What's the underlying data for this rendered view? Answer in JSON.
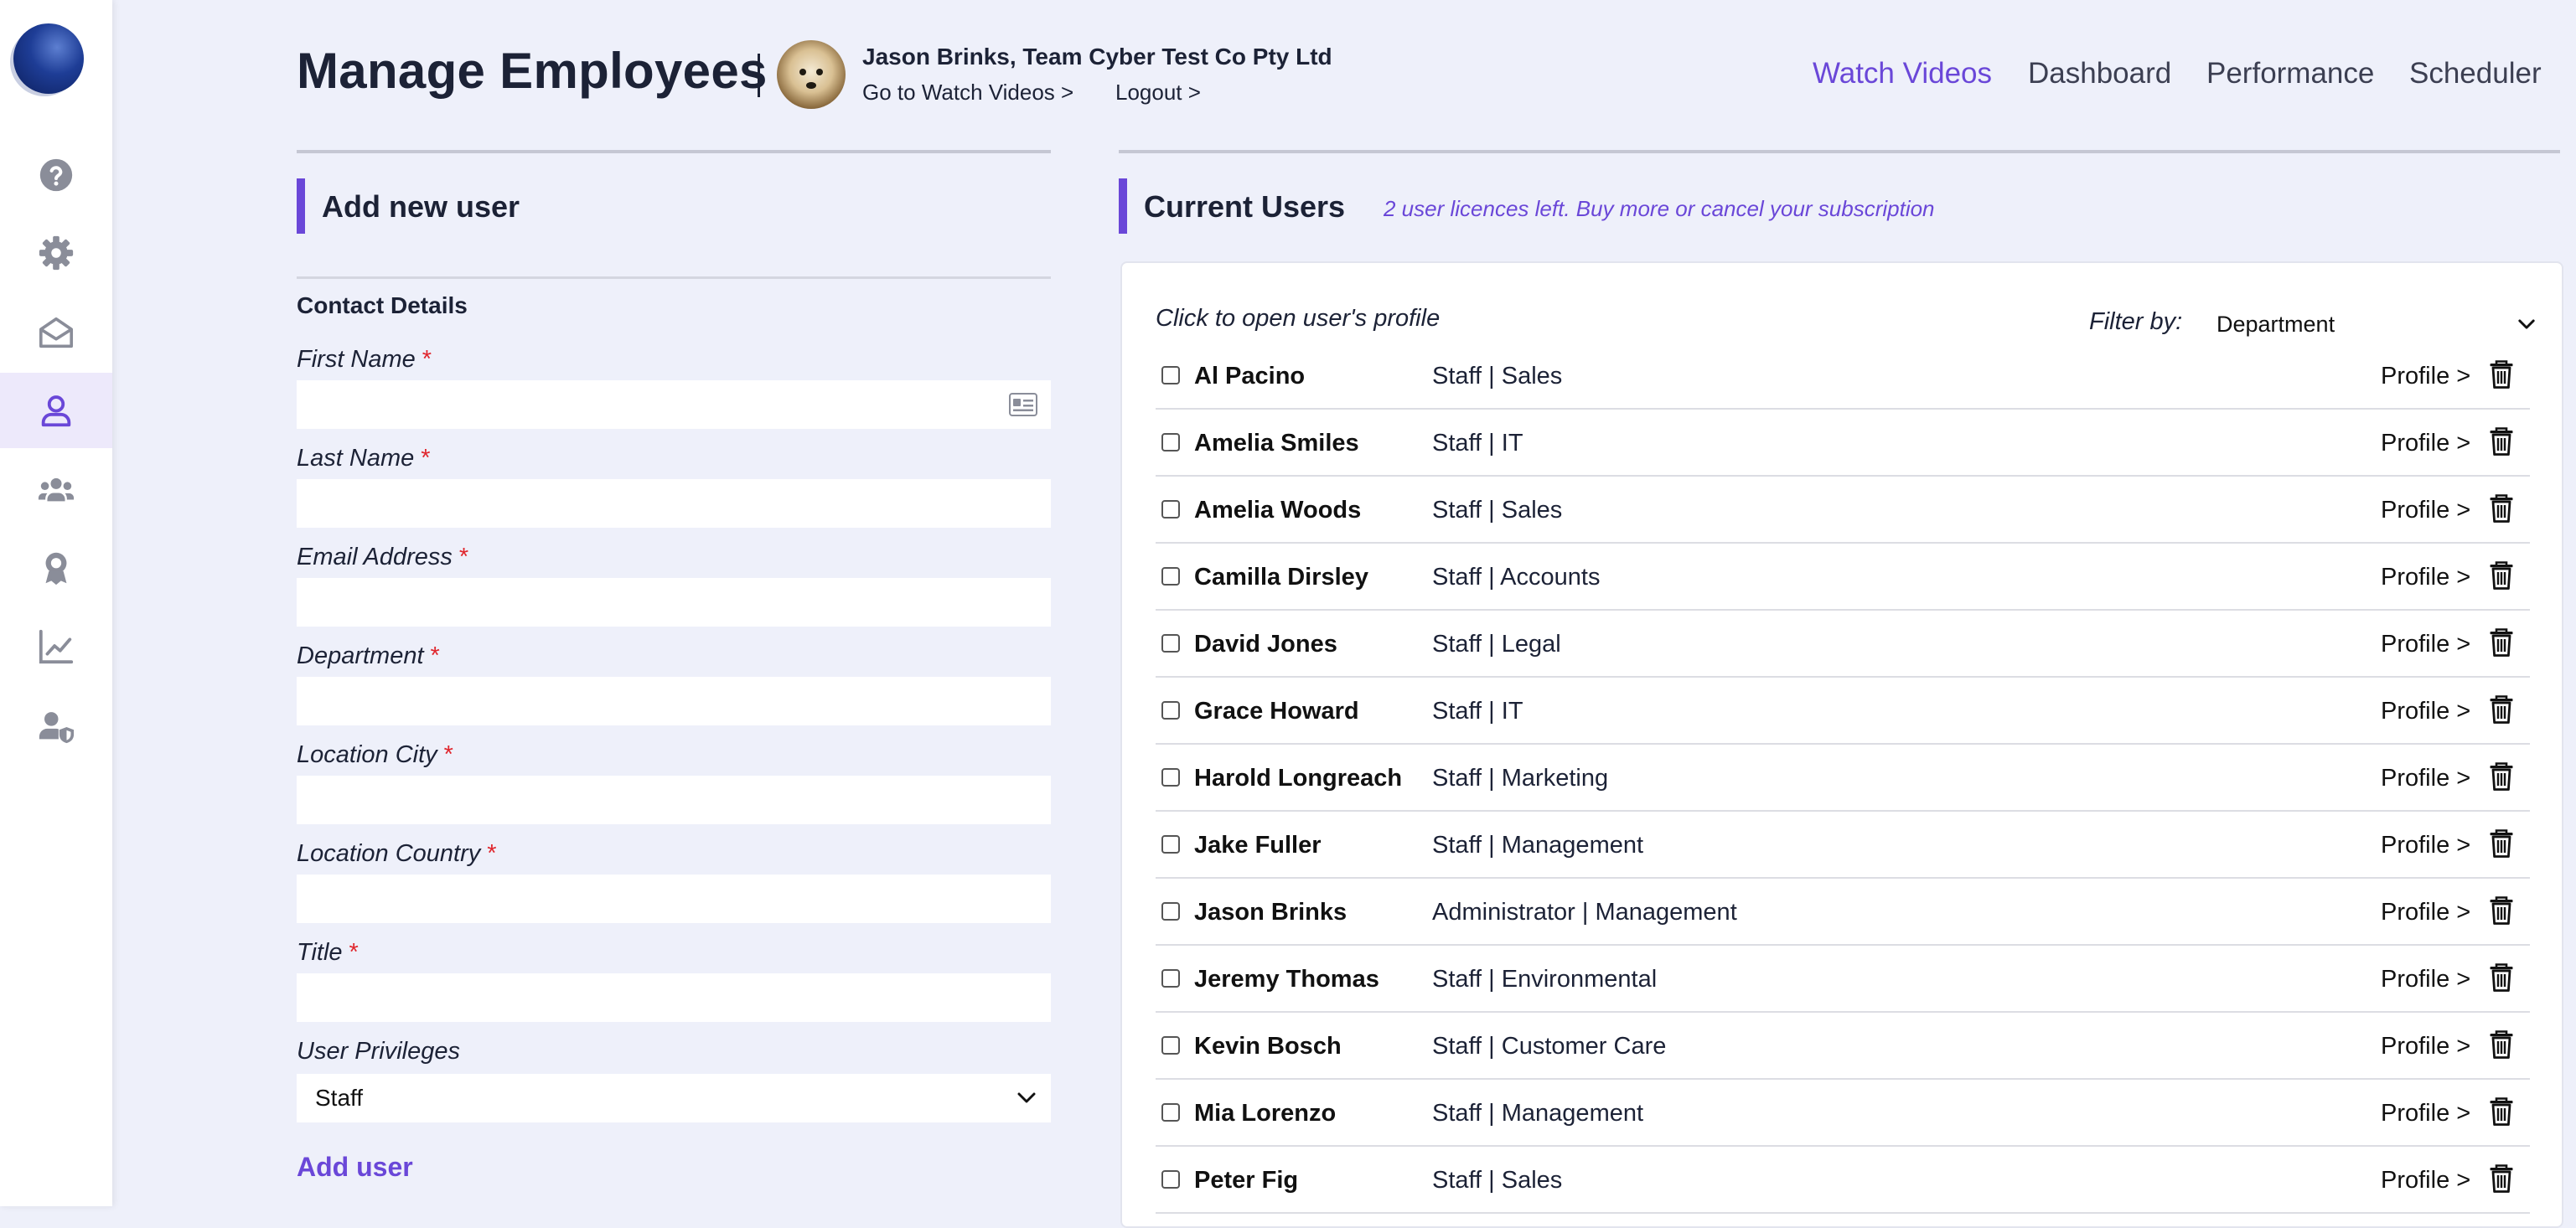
{
  "page": {
    "title": "Manage Employees"
  },
  "user": {
    "name": "Jason Brinks, Team Cyber Test Co Pty Ltd",
    "watch_link": "Go to Watch Videos >",
    "logout_link": "Logout >"
  },
  "nav": {
    "items": [
      "Watch Videos",
      "Dashboard",
      "Performance",
      "Scheduler"
    ],
    "active": "Watch Videos"
  },
  "sidebar": {
    "items": [
      {
        "icon": "help-icon"
      },
      {
        "icon": "gear-icon"
      },
      {
        "icon": "mail-icon"
      },
      {
        "icon": "user-icon",
        "active": true
      },
      {
        "icon": "group-icon"
      },
      {
        "icon": "award-icon"
      },
      {
        "icon": "chart-icon"
      },
      {
        "icon": "user-shield-icon"
      }
    ]
  },
  "add_user": {
    "title": "Add new user",
    "group_title": "Contact Details",
    "fields": [
      {
        "label": "First Name",
        "value": "",
        "required": "*"
      },
      {
        "label": "Last Name",
        "value": "",
        "required": "*"
      },
      {
        "label": "Email Address",
        "value": "",
        "required": "*"
      },
      {
        "label": "Department",
        "value": "",
        "required": "*"
      },
      {
        "label": "Location City",
        "value": "",
        "required": "*"
      },
      {
        "label": "Location Country",
        "value": "",
        "required": "*"
      },
      {
        "label": "Title",
        "value": "",
        "required": "*"
      }
    ],
    "privileges_label": "User Privileges",
    "privileges_value": "Staff",
    "submit_label": "Add user"
  },
  "current_users": {
    "title": "Current Users",
    "licence_note": "2 user licences left. Buy more or cancel your subscription",
    "hint": "Click to open user's profile",
    "filter_label": "Filter by:",
    "filter_value": "Department",
    "profile_label": "Profile >",
    "rows": [
      {
        "name": "Al Pacino",
        "role": "Staff | Sales"
      },
      {
        "name": "Amelia Smiles",
        "role": "Staff | IT"
      },
      {
        "name": "Amelia Woods",
        "role": "Staff | Sales"
      },
      {
        "name": "Camilla Dirsley",
        "role": "Staff | Accounts"
      },
      {
        "name": "David Jones",
        "role": "Staff | Legal"
      },
      {
        "name": "Grace Howard",
        "role": "Staff | IT"
      },
      {
        "name": "Harold Longreach",
        "role": "Staff | Marketing"
      },
      {
        "name": "Jake Fuller",
        "role": "Staff | Management"
      },
      {
        "name": "Jason Brinks",
        "role": "Administrator | Management"
      },
      {
        "name": "Jeremy Thomas",
        "role": "Staff | Environmental"
      },
      {
        "name": "Kevin Bosch",
        "role": "Staff | Customer Care"
      },
      {
        "name": "Mia Lorenzo",
        "role": "Staff | Management"
      },
      {
        "name": "Peter Fig",
        "role": "Staff | Sales"
      }
    ]
  },
  "colors": {
    "accent": "#6a47d8",
    "required": "#e0262d",
    "background": "#eef0fa"
  }
}
